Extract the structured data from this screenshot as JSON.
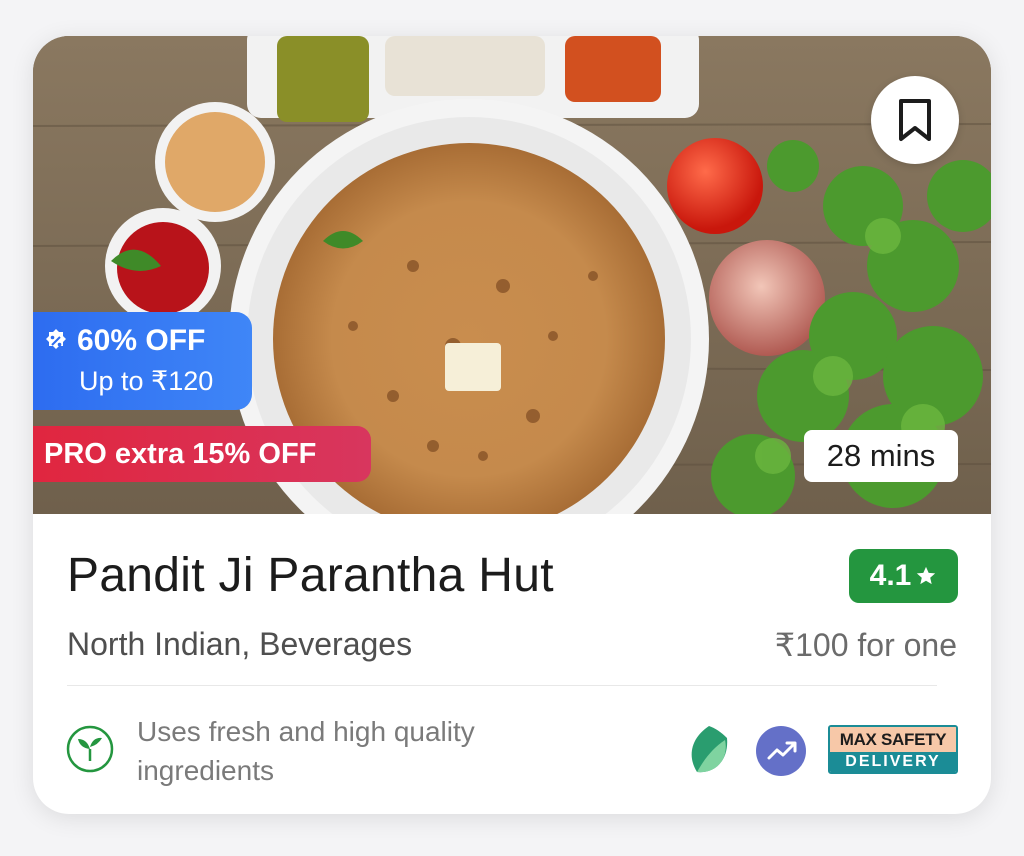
{
  "restaurant": {
    "name": "Pandit Ji Parantha Hut",
    "rating": "4.1",
    "cuisines": "North Indian, Beverages",
    "price": "₹100 for one",
    "eta": "28 mins"
  },
  "offers": {
    "discount": "60% OFF",
    "cap": "Up to ₹120",
    "pro": "PRO extra 15% OFF"
  },
  "footer": {
    "fresh_text": "Uses fresh and high quality ingredients",
    "safety_top": "MAX SAFETY",
    "safety_bottom": "DELIVERY"
  },
  "icons": {
    "bookmark": "bookmark-icon",
    "offer": "discount-icon",
    "star": "star-icon",
    "fresh": "sprout-icon",
    "leaf": "leaf-icon",
    "trend": "trend-up-icon"
  },
  "colors": {
    "rating_bg": "#24963f",
    "offer_bg": "#2d6cf0",
    "pro_bg": "#e0263f",
    "safety": "#1b8c96"
  }
}
